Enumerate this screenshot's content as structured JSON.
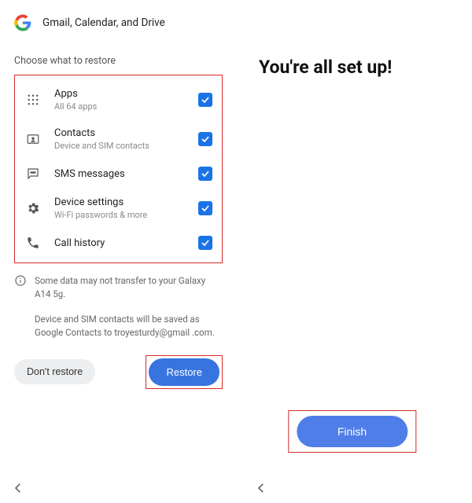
{
  "left": {
    "header_title": "Gmail, Calendar, and Drive",
    "subhead": "Choose what to restore",
    "items": [
      {
        "label": "Apps",
        "sub": "All 64 apps"
      },
      {
        "label": "Contacts",
        "sub": "Device and SIM contacts"
      },
      {
        "label": "SMS messages",
        "sub": ""
      },
      {
        "label": "Device settings",
        "sub": "Wi-Fi passwords & more"
      },
      {
        "label": "Call history",
        "sub": ""
      }
    ],
    "info1": "Some data may not transfer to your Galaxy A14 5g.",
    "info2": "Device and SIM contacts will be saved as Google Contacts to troyesturdy@gmail .com.",
    "dont_restore": "Don't restore",
    "restore": "Restore"
  },
  "right": {
    "heading": "You're all set up!",
    "finish": "Finish"
  },
  "colors": {
    "accent": "#1a73e8",
    "highlight": "#d42a2a"
  }
}
